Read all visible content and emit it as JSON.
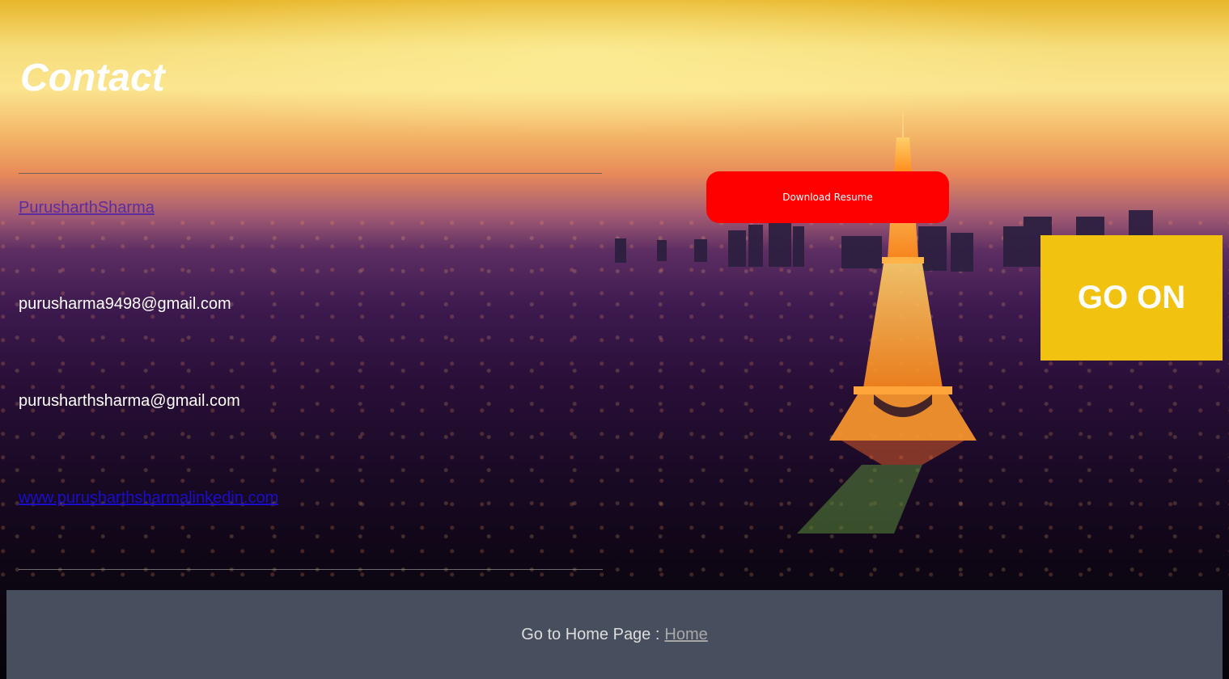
{
  "page": {
    "title": "Contact"
  },
  "contact": {
    "name": "PurusharthSharma",
    "email_primary": "purusharma9498@gmail.com",
    "email_secondary": "purusharthsharma@gmail.com",
    "linkedin": "www.purusharthsharmalinkedin.com"
  },
  "actions": {
    "download_resume_label": "Download Resume",
    "go_on_label": "GO ON"
  },
  "footer": {
    "prefix": "Go to Home Page :",
    "home_link_label": "Home"
  },
  "colors": {
    "download_button": "#ff0000",
    "go_on_button": "#f1c20f",
    "footer_background": "#474e5d",
    "side_accent": "#f1c40f"
  },
  "background": {
    "icon": "eiffel-tower-night-city-image"
  }
}
